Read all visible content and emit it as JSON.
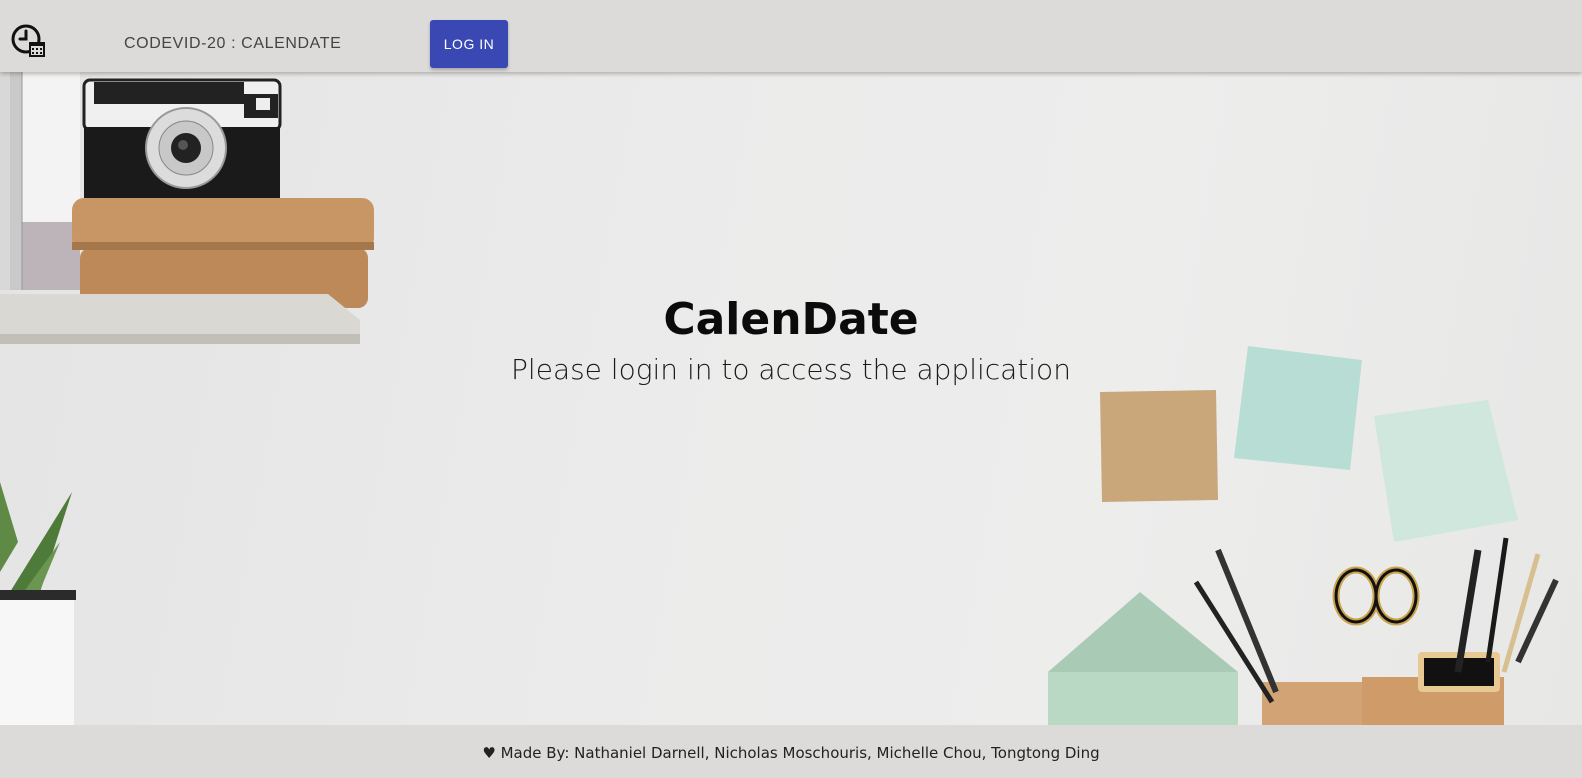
{
  "header": {
    "title": "CODEVID-20 : CALENDATE",
    "login_label": "LOG IN",
    "logo_icon": "clock-calendar-icon"
  },
  "hero": {
    "title": "CalenDate",
    "subtitle": "Please login in to access the application"
  },
  "footer": {
    "text": "♥ Made By: Nathaniel Darnell, Nicholas Moschouris, Michelle Chou, Tongtong Ding"
  },
  "colors": {
    "header_bg": "#dcdbda",
    "button_bg": "#3948b3",
    "button_text": "#ffffff"
  }
}
